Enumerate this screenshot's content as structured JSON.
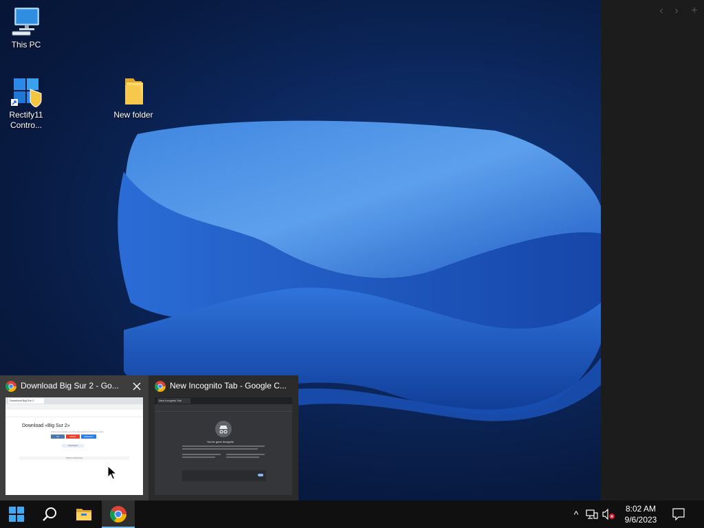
{
  "desktop": {
    "icons": [
      {
        "label": "This PC",
        "icon": "computer-icon"
      },
      {
        "label": "Rectify11 Contro...",
        "icon": "control-panel-icon"
      },
      {
        "label": "New folder",
        "icon": "folder-icon"
      }
    ]
  },
  "side_panel": {
    "buttons": [
      "‹",
      "›",
      "+"
    ]
  },
  "thumbnails": [
    {
      "title": "Download Big Sur 2 - Go...",
      "icon": "chrome-icon",
      "page": {
        "tab_label": "Download Big Sur 2",
        "heading": "Download «Big Sur 2»",
        "sub": "In the new window you can download the full theme pack.",
        "buttons": [
          "VK",
          "Reddit",
          "Mastodon"
        ],
        "download_label": "Download",
        "footer": "Click to visit home"
      }
    },
    {
      "title": "New Incognito Tab - Google C...",
      "icon": "chrome-icon",
      "page": {
        "tab_label": "New Incognito Tab",
        "heading": "You've gone Incognito"
      }
    }
  ],
  "taskbar": {
    "apps": [
      {
        "name": "start",
        "icon": "windows-logo-icon"
      },
      {
        "name": "search",
        "icon": "search-icon"
      },
      {
        "name": "file-explorer",
        "icon": "folder-icon"
      },
      {
        "name": "chrome",
        "icon": "chrome-icon",
        "active": true
      }
    ],
    "tray": {
      "chevron": "^",
      "time": "8:02 AM",
      "date": "9/6/2023"
    }
  },
  "colors": {
    "accent": "#76b9ed",
    "taskbar": "#101010",
    "popup": "#2b2b2b"
  }
}
